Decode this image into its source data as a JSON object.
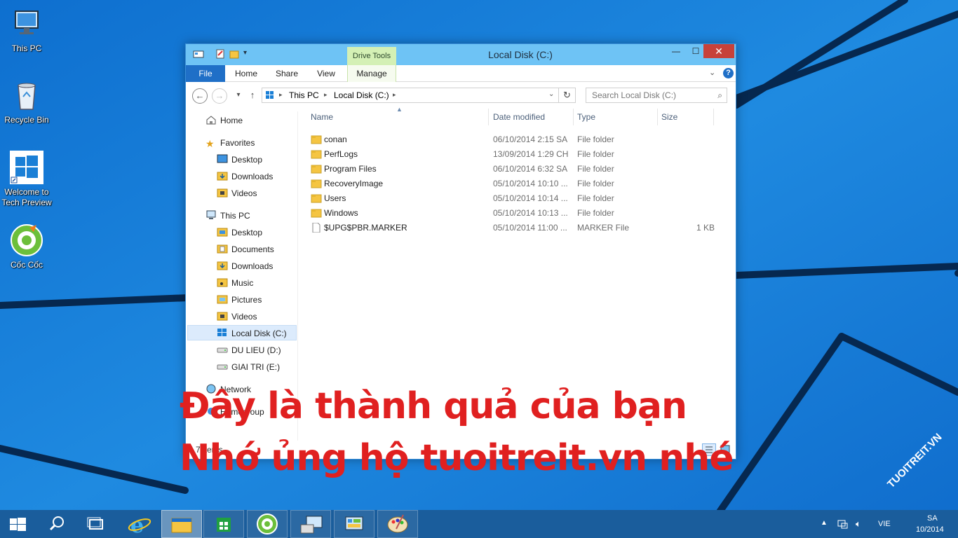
{
  "desktop": {
    "icons": [
      {
        "label": "This PC",
        "icon": "this-pc-icon"
      },
      {
        "label": "Recycle Bin",
        "icon": "recycle-bin-icon"
      },
      {
        "label_line1": "Welcome to",
        "label_line2": "Tech Preview",
        "icon": "windows-logo-icon"
      },
      {
        "label": "Cốc Cốc",
        "icon": "coccoc-icon"
      }
    ]
  },
  "window": {
    "title": "Local Disk (C:)",
    "contextual_tab": "Drive Tools",
    "ribbon_tabs": [
      "File",
      "Home",
      "Share",
      "View",
      "Manage"
    ],
    "address": {
      "segments": [
        "This PC",
        "Local Disk (C:)"
      ]
    },
    "search_placeholder": "Search Local Disk (C:)",
    "nav": {
      "home": "Home",
      "favorites": "Favorites",
      "fav_items": [
        "Desktop",
        "Downloads",
        "Videos"
      ],
      "this_pc": "This PC",
      "pc_items": [
        "Desktop",
        "Documents",
        "Downloads",
        "Music",
        "Pictures",
        "Videos"
      ],
      "drives": [
        "Local Disk (C:)",
        "DU LIEU (D:)",
        "GIAI TRI (E:)"
      ],
      "network": "Network",
      "homegroup": "Homegroup"
    },
    "columns": [
      "Name",
      "Date modified",
      "Type",
      "Size"
    ],
    "files": [
      {
        "name": "conan",
        "date": "06/10/2014 2:15 SA",
        "type": "File folder",
        "size": ""
      },
      {
        "name": "PerfLogs",
        "date": "13/09/2014 1:29 CH",
        "type": "File folder",
        "size": ""
      },
      {
        "name": "Program Files",
        "date": "06/10/2014 6:32 SA",
        "type": "File folder",
        "size": ""
      },
      {
        "name": "RecoveryImage",
        "date": "05/10/2014 10:10 ...",
        "type": "File folder",
        "size": ""
      },
      {
        "name": "Users",
        "date": "05/10/2014 10:14 ...",
        "type": "File folder",
        "size": ""
      },
      {
        "name": "Windows",
        "date": "05/10/2014 10:13 ...",
        "type": "File folder",
        "size": ""
      },
      {
        "name": "$UPG$PBR.MARKER",
        "date": "05/10/2014 11:00 ...",
        "type": "MARKER File",
        "size": "1 KB"
      }
    ],
    "status": "7 items"
  },
  "overlay": {
    "line1": "Đây là thành quả của bạn",
    "line2": "Nhớ ủng hộ tuoitreit.vn nhé"
  },
  "taskbar": {
    "language": "VIE",
    "clock_line1": "SA",
    "clock_line2": "10/2014",
    "watermark": "TUOITREIT.VN"
  },
  "colors": {
    "overlay_red": "#e02020",
    "desktop_blue": "#1a7fd6",
    "taskbar_blue": "#1a5d9c",
    "title_blue": "#6ec3f5",
    "file_tab_blue": "#1f6fc7",
    "close_red": "#c7413a"
  }
}
